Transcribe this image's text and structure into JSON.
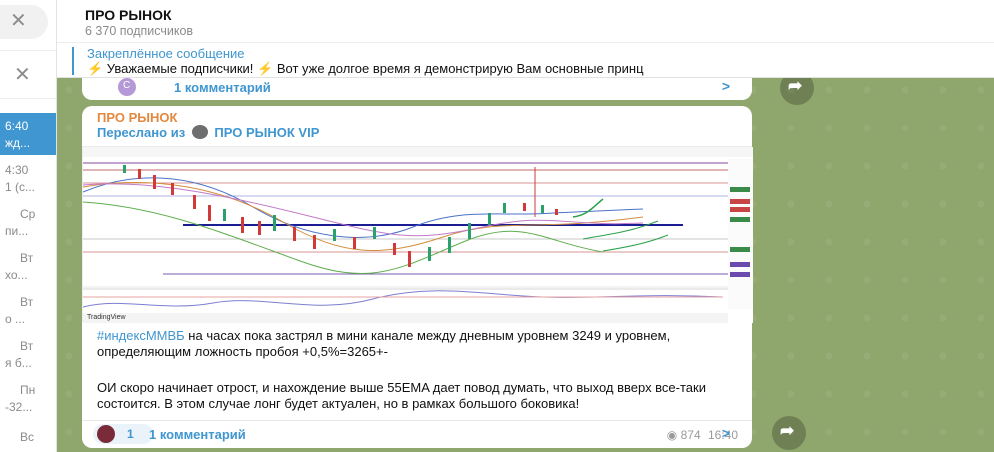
{
  "sidebar": {
    "items": [
      {
        "time": "6:40",
        "preview": "жд..."
      },
      {
        "time": "4:30",
        "preview": "1 (с..."
      },
      {
        "time": "Ср",
        "preview": "пи..."
      },
      {
        "time": "Вт",
        "preview": "хо..."
      },
      {
        "time": "Вт",
        "preview": "о ..."
      },
      {
        "time": "Вт",
        "preview": "я б..."
      },
      {
        "time": "Пн",
        "preview": "-32..."
      },
      {
        "time": "Вс",
        "preview": ""
      }
    ]
  },
  "channel": {
    "title": "ПРО РЫНОК",
    "subscribers": "6 370 подписчиков"
  },
  "pinned": {
    "label": "Закреплённое сообщение",
    "text": "⚡ Уважаемые подписчики! ⚡  Вот уже долгое время я демонстрирую Вам основные принц"
  },
  "top_comments": {
    "avatar_letter": "С",
    "label": "1 комментарий"
  },
  "post": {
    "channel_name": "ПРО РЫНОК",
    "forwarded_prefix": "Переслано из",
    "forwarded_source": "ПРО РЫНОК VIP",
    "hashtag": "#индексМMВБ",
    "para1_rest": " на часах пока застрял в мини канале между дневным  уровнем 3249 и уровнем, определяющим ложность пробоя +0,5%=3265+-",
    "para2": "ОИ скоро начинает отрост, и нахождение выше 55EMA дает повод думать, что выход вверх все-таки состоится. В этом случае лонг будет актуален, но в рамках большого боковика!",
    "reaction_emoji": "👍",
    "reaction_count": "1",
    "views": "874",
    "time": "16:40",
    "comments_label": "1 комментарий"
  },
  "chart_image": {
    "watermark": "TradingView"
  },
  "colors": {
    "accent": "#3f96d0",
    "channel_name": "#e3893f",
    "chat_bg": "#8fa66c"
  }
}
